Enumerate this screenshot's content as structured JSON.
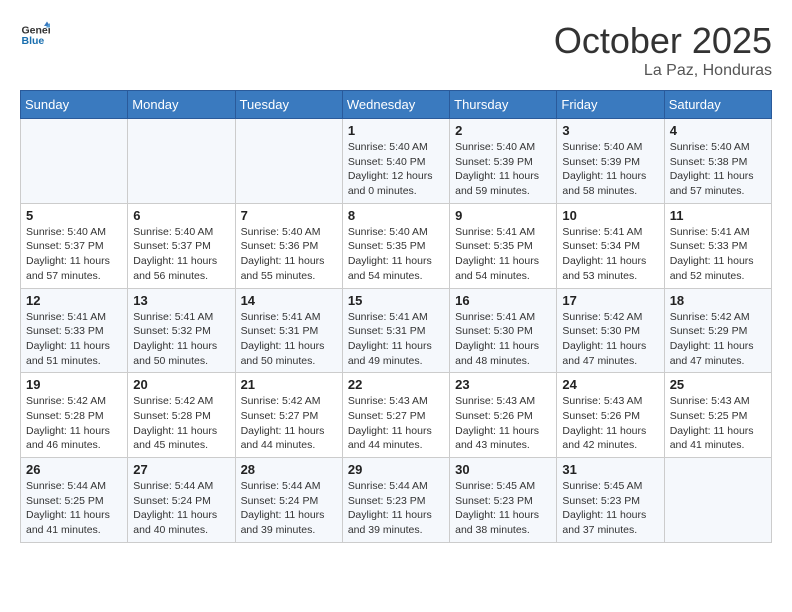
{
  "header": {
    "logo_line1": "General",
    "logo_line2": "Blue",
    "month": "October 2025",
    "location": "La Paz, Honduras"
  },
  "weekdays": [
    "Sunday",
    "Monday",
    "Tuesday",
    "Wednesday",
    "Thursday",
    "Friday",
    "Saturday"
  ],
  "weeks": [
    [
      {
        "day": "",
        "info": ""
      },
      {
        "day": "",
        "info": ""
      },
      {
        "day": "",
        "info": ""
      },
      {
        "day": "1",
        "info": "Sunrise: 5:40 AM\nSunset: 5:40 PM\nDaylight: 12 hours\nand 0 minutes."
      },
      {
        "day": "2",
        "info": "Sunrise: 5:40 AM\nSunset: 5:39 PM\nDaylight: 11 hours\nand 59 minutes."
      },
      {
        "day": "3",
        "info": "Sunrise: 5:40 AM\nSunset: 5:39 PM\nDaylight: 11 hours\nand 58 minutes."
      },
      {
        "day": "4",
        "info": "Sunrise: 5:40 AM\nSunset: 5:38 PM\nDaylight: 11 hours\nand 57 minutes."
      }
    ],
    [
      {
        "day": "5",
        "info": "Sunrise: 5:40 AM\nSunset: 5:37 PM\nDaylight: 11 hours\nand 57 minutes."
      },
      {
        "day": "6",
        "info": "Sunrise: 5:40 AM\nSunset: 5:37 PM\nDaylight: 11 hours\nand 56 minutes."
      },
      {
        "day": "7",
        "info": "Sunrise: 5:40 AM\nSunset: 5:36 PM\nDaylight: 11 hours\nand 55 minutes."
      },
      {
        "day": "8",
        "info": "Sunrise: 5:40 AM\nSunset: 5:35 PM\nDaylight: 11 hours\nand 54 minutes."
      },
      {
        "day": "9",
        "info": "Sunrise: 5:41 AM\nSunset: 5:35 PM\nDaylight: 11 hours\nand 54 minutes."
      },
      {
        "day": "10",
        "info": "Sunrise: 5:41 AM\nSunset: 5:34 PM\nDaylight: 11 hours\nand 53 minutes."
      },
      {
        "day": "11",
        "info": "Sunrise: 5:41 AM\nSunset: 5:33 PM\nDaylight: 11 hours\nand 52 minutes."
      }
    ],
    [
      {
        "day": "12",
        "info": "Sunrise: 5:41 AM\nSunset: 5:33 PM\nDaylight: 11 hours\nand 51 minutes."
      },
      {
        "day": "13",
        "info": "Sunrise: 5:41 AM\nSunset: 5:32 PM\nDaylight: 11 hours\nand 50 minutes."
      },
      {
        "day": "14",
        "info": "Sunrise: 5:41 AM\nSunset: 5:31 PM\nDaylight: 11 hours\nand 50 minutes."
      },
      {
        "day": "15",
        "info": "Sunrise: 5:41 AM\nSunset: 5:31 PM\nDaylight: 11 hours\nand 49 minutes."
      },
      {
        "day": "16",
        "info": "Sunrise: 5:41 AM\nSunset: 5:30 PM\nDaylight: 11 hours\nand 48 minutes."
      },
      {
        "day": "17",
        "info": "Sunrise: 5:42 AM\nSunset: 5:30 PM\nDaylight: 11 hours\nand 47 minutes."
      },
      {
        "day": "18",
        "info": "Sunrise: 5:42 AM\nSunset: 5:29 PM\nDaylight: 11 hours\nand 47 minutes."
      }
    ],
    [
      {
        "day": "19",
        "info": "Sunrise: 5:42 AM\nSunset: 5:28 PM\nDaylight: 11 hours\nand 46 minutes."
      },
      {
        "day": "20",
        "info": "Sunrise: 5:42 AM\nSunset: 5:28 PM\nDaylight: 11 hours\nand 45 minutes."
      },
      {
        "day": "21",
        "info": "Sunrise: 5:42 AM\nSunset: 5:27 PM\nDaylight: 11 hours\nand 44 minutes."
      },
      {
        "day": "22",
        "info": "Sunrise: 5:43 AM\nSunset: 5:27 PM\nDaylight: 11 hours\nand 44 minutes."
      },
      {
        "day": "23",
        "info": "Sunrise: 5:43 AM\nSunset: 5:26 PM\nDaylight: 11 hours\nand 43 minutes."
      },
      {
        "day": "24",
        "info": "Sunrise: 5:43 AM\nSunset: 5:26 PM\nDaylight: 11 hours\nand 42 minutes."
      },
      {
        "day": "25",
        "info": "Sunrise: 5:43 AM\nSunset: 5:25 PM\nDaylight: 11 hours\nand 41 minutes."
      }
    ],
    [
      {
        "day": "26",
        "info": "Sunrise: 5:44 AM\nSunset: 5:25 PM\nDaylight: 11 hours\nand 41 minutes."
      },
      {
        "day": "27",
        "info": "Sunrise: 5:44 AM\nSunset: 5:24 PM\nDaylight: 11 hours\nand 40 minutes."
      },
      {
        "day": "28",
        "info": "Sunrise: 5:44 AM\nSunset: 5:24 PM\nDaylight: 11 hours\nand 39 minutes."
      },
      {
        "day": "29",
        "info": "Sunrise: 5:44 AM\nSunset: 5:23 PM\nDaylight: 11 hours\nand 39 minutes."
      },
      {
        "day": "30",
        "info": "Sunrise: 5:45 AM\nSunset: 5:23 PM\nDaylight: 11 hours\nand 38 minutes."
      },
      {
        "day": "31",
        "info": "Sunrise: 5:45 AM\nSunset: 5:23 PM\nDaylight: 11 hours\nand 37 minutes."
      },
      {
        "day": "",
        "info": ""
      }
    ]
  ]
}
